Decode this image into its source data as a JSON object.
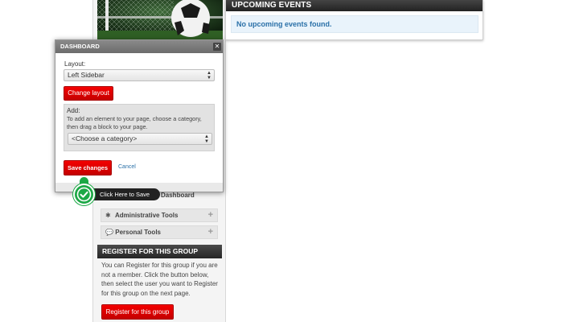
{
  "events": {
    "header": "UPCOMING EVENTS",
    "empty_message": "No upcoming events found."
  },
  "modal": {
    "title": "DASHBOARD",
    "close_glyph": "✕",
    "layout_label": "Layout:",
    "layout_value": "Left Sidebar",
    "change_layout_label": "Change layout",
    "add_label": "Add:",
    "add_description": "To add an element to your page, choose a category, then drag a block to your page.",
    "category_value": "<Choose a category>",
    "save_label": "Save changes",
    "cancel_label": "Cancel"
  },
  "tooltip": {
    "text": "Click Here to Save",
    "icon": "check-icon",
    "color": "#1ba845"
  },
  "sidebar": {
    "peek_label": "Dashboard",
    "items": [
      {
        "label": "Administrative Tools",
        "icon": "gear-icon"
      },
      {
        "label": "Personal Tools",
        "icon": "chat-icon"
      }
    ]
  },
  "register": {
    "header": "REGISTER FOR THIS GROUP",
    "text": "You can Register for this group if you are not a member. Click the button below, then select the user you want to Register for this group on the next page.",
    "button_label": "Register for this group"
  },
  "colors": {
    "accent_red": "#dd0000",
    "link_blue": "#2a70a8",
    "dark_header": "#2b2b2b"
  }
}
